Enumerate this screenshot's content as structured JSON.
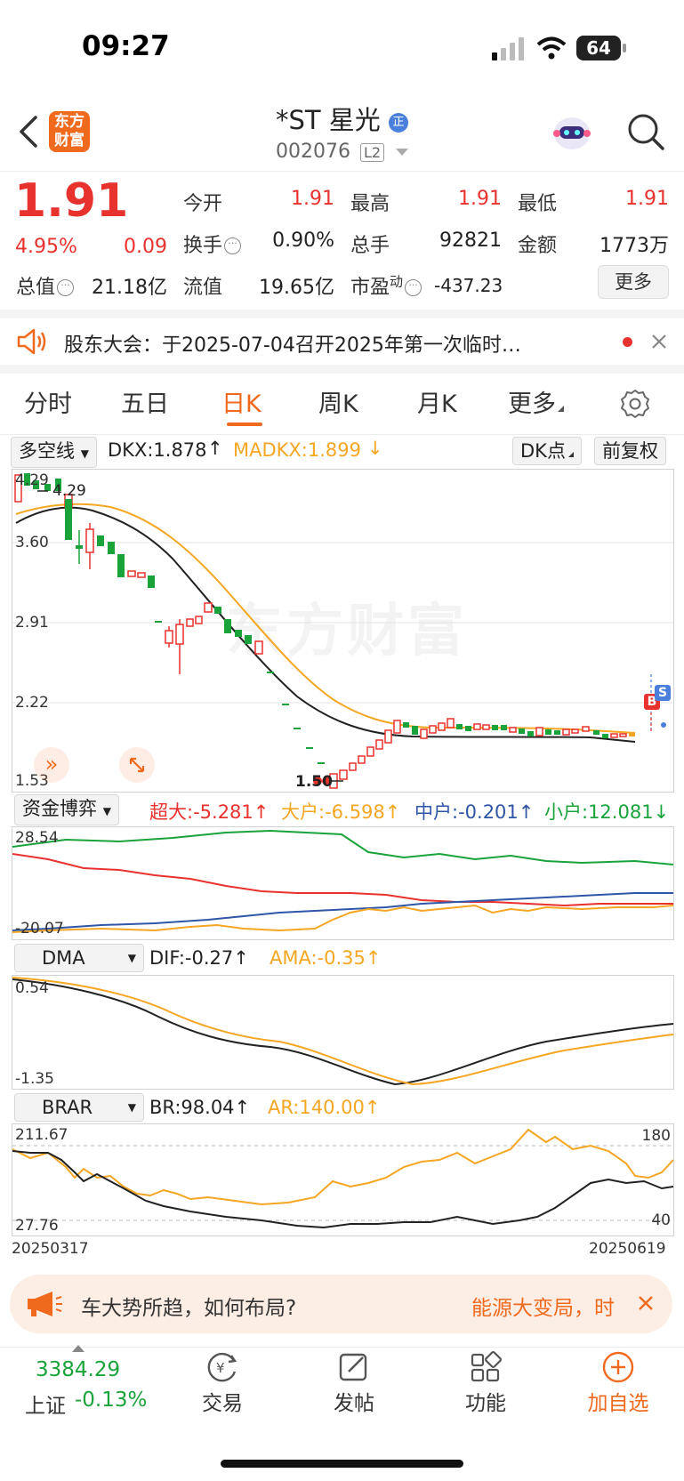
{
  "status_bar": {
    "time": "09:27",
    "battery": "64"
  },
  "header": {
    "logo_text": "东方财富",
    "stock_name": "*ST 星光",
    "name_badge": "正",
    "stock_code": "002076",
    "level_badge": "L2"
  },
  "quote": {
    "price": "1.91",
    "change_pct": "4.95%",
    "change_abs": "0.09",
    "open_label": "今开",
    "open": "1.91",
    "high_label": "最高",
    "high": "1.91",
    "low_label": "最低",
    "low": "1.91",
    "turnover_label": "换手",
    "turnover": "0.90%",
    "volume_label": "总手",
    "volume": "92821",
    "amount_label": "金额",
    "amount": "1773万",
    "total_cap_label": "总值",
    "total_cap": "21.18亿",
    "float_cap_label": "流值",
    "float_cap": "19.65亿",
    "pe_label": "市盈",
    "pe_sup": "动",
    "pe": "-437.23",
    "more_button": "更多"
  },
  "notice": {
    "text": "股东大会：于2025-07-04召开2025年第一次临时…"
  },
  "tabs": [
    "分时",
    "五日",
    "日K",
    "周K",
    "月K",
    "更多"
  ],
  "active_tab": "日K",
  "kline": {
    "indicator_select": "多空线",
    "dkx": "DKX:1.878",
    "madkx": "MADKX:1.899",
    "dk_button": "DK点",
    "adjust_button": "前复权",
    "y_labels": [
      "4.29",
      "3.60",
      "2.91",
      "2.22",
      "1.53"
    ],
    "high_marker": "4.29",
    "low_marker": "1.50",
    "watermark": "东方财富",
    "b_marker": "B",
    "s_marker": "S"
  },
  "fund_flow": {
    "select": "资金博弈",
    "super_large": "超大:-5.281",
    "large": "大户:-6.598",
    "medium": "中户:-0.201",
    "small": "小户:12.081",
    "y_top": "28.54",
    "y_bottom": "-20.07"
  },
  "dma": {
    "select": "DMA",
    "dif": "DIF:-0.27",
    "ama": "AMA:-0.35",
    "y_top": "0.54",
    "y_bottom": "-1.35"
  },
  "brar": {
    "select": "BRAR",
    "br": "BR:98.04",
    "ar": "AR:140.00",
    "y_top": "211.67",
    "y_bottom": "27.76",
    "ref_high": "180",
    "ref_low": "40",
    "date_start": "20250317",
    "date_end": "20250619"
  },
  "ad_banner": {
    "left_text": "车大势所趋，如何布局?",
    "right_text": "能源大变局，时"
  },
  "bottom_nav": {
    "index_value": "3384.29",
    "index_name": "上证",
    "index_change": "-0.13%",
    "items": [
      "交易",
      "发帖",
      "功能",
      "加自选"
    ]
  },
  "colors": {
    "up": "#e8322e",
    "down": "#1aa33a",
    "accent": "#f06a1e",
    "ma_yellow": "#f5a623",
    "blue": "#2f56a6"
  }
}
